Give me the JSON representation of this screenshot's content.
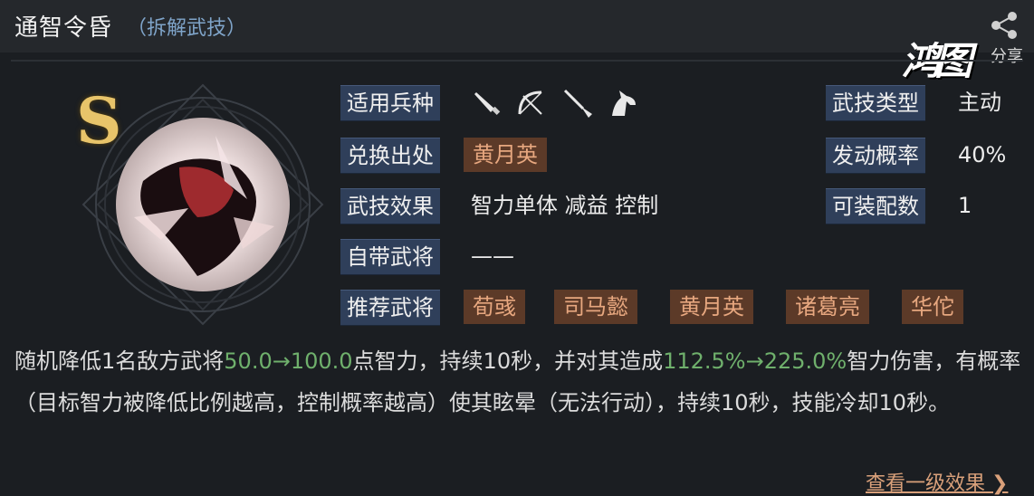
{
  "header": {
    "title": "通智令昏",
    "subtitle": "（拆解武技）",
    "share_label": "分享",
    "logo_text": "鸿图"
  },
  "skill": {
    "rank": "S",
    "rows": {
      "unit_type": {
        "label": "适用兵种",
        "icons": [
          "sword-icon",
          "bow-icon",
          "spear-icon",
          "horse-icon"
        ]
      },
      "source": {
        "label": "兑换出处",
        "tag": "黄月英"
      },
      "effect": {
        "label": "武技效果",
        "value": "智力单体 减益 控制"
      },
      "own_general": {
        "label": "自带武将",
        "value": "——"
      },
      "recommended": {
        "label": "推荐武将",
        "tags": [
          "荀彧",
          "司马懿",
          "黄月英",
          "诸葛亮",
          "华佗"
        ]
      }
    },
    "right": {
      "type": {
        "label": "武技类型",
        "value": "主动"
      },
      "chance": {
        "label": "发动概率",
        "value": "40%"
      },
      "equip": {
        "label": "可装配数",
        "value": "1"
      }
    }
  },
  "description": {
    "p1": "随机降低1名敌方武将",
    "v1": "50.0→100.0",
    "p2": "点智力，持续10秒，并对其造成",
    "v2": "112.5%→225.0%",
    "p3": "智力伤害，有概率（目标智力被降低比例越高，控制概率越高）使其眩晕（无法行动），持续10秒，技能冷却10秒。"
  },
  "footer": {
    "more_label": "查看一级效果",
    "more_icon": "chevron-right-icon"
  },
  "colors": {
    "accent_green": "#6fb06c",
    "tag_bg": "#5c3a28",
    "label_bg": "#2f3f5a"
  }
}
